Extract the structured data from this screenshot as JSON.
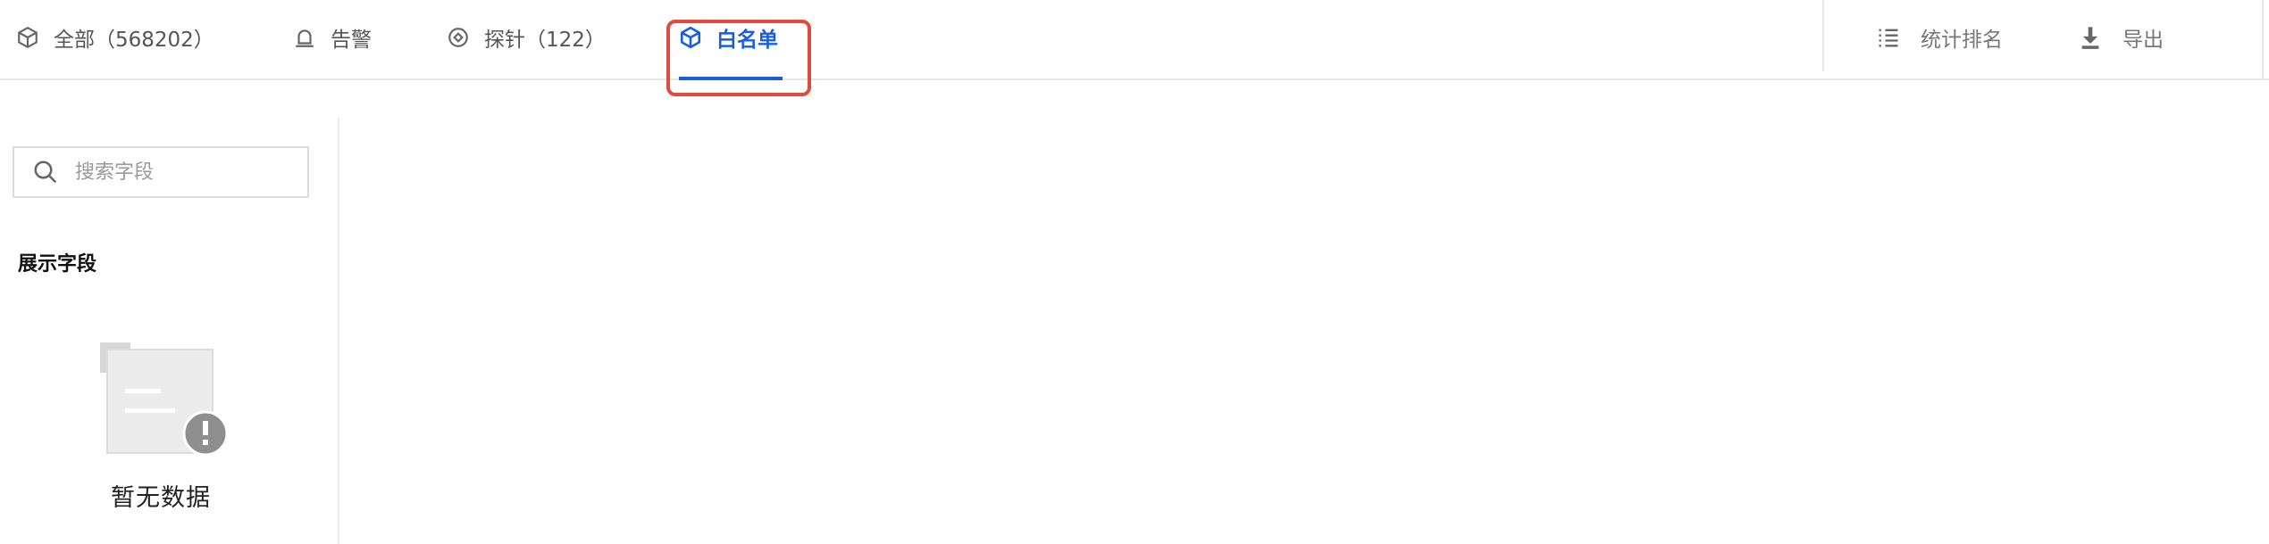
{
  "tabs": [
    {
      "label": "全部（568202）",
      "icon": "cube-icon",
      "active": false
    },
    {
      "label": "告警",
      "icon": "alarm-icon",
      "active": false
    },
    {
      "label": "探针（122）",
      "icon": "probe-icon",
      "active": false
    },
    {
      "label": "白名单",
      "icon": "cube-icon",
      "active": true
    }
  ],
  "actions": {
    "ranking_label": "统计排名",
    "export_label": "导出"
  },
  "sidebar": {
    "search_placeholder": "搜索字段",
    "section_title": "展示字段",
    "empty_text": "暂无数据"
  },
  "colors": {
    "accent": "#1a5fd9",
    "highlight": "#e34a3f"
  }
}
